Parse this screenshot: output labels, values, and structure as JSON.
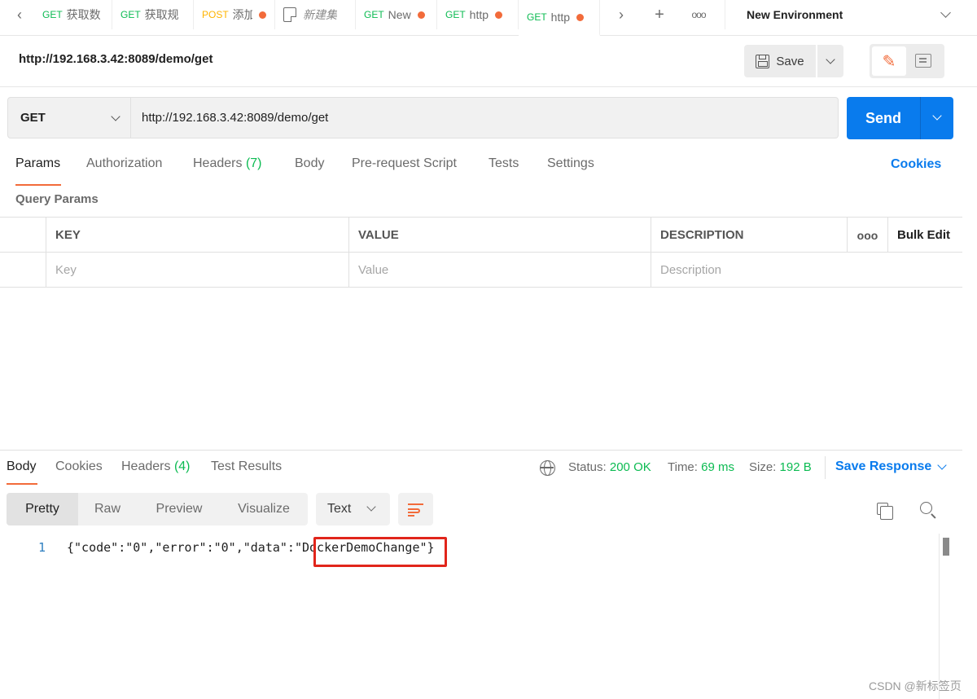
{
  "tabs": [
    {
      "method": "GET",
      "name": "获取数",
      "dot": false
    },
    {
      "method": "GET",
      "name": "获取规",
      "dot": false
    },
    {
      "method": "POST",
      "name": "添加",
      "dot": true
    },
    {
      "method": "",
      "name": "新建集",
      "dot": false
    },
    {
      "method": "GET",
      "name": "New",
      "dot": true
    },
    {
      "method": "GET",
      "name": "http",
      "dot": true
    },
    {
      "method": "GET",
      "name": "http",
      "dot": true
    }
  ],
  "environment": {
    "label": "New Environment"
  },
  "request": {
    "title": "http://192.168.3.42:8089/demo/get",
    "save_label": "Save",
    "method": "GET",
    "url": "http://192.168.3.42:8089/demo/get",
    "send_label": "Send"
  },
  "request_tabs": {
    "params": "Params",
    "authorization": "Authorization",
    "headers": "Headers",
    "headers_count": "(7)",
    "body": "Body",
    "prerequest": "Pre-request Script",
    "tests": "Tests",
    "settings": "Settings",
    "cookies": "Cookies"
  },
  "query_params": {
    "label": "Query Params",
    "columns": {
      "key": "KEY",
      "value": "VALUE",
      "description": "DESCRIPTION",
      "bulk_edit": "Bulk Edit"
    },
    "placeholders": {
      "key": "Key",
      "value": "Value",
      "description": "Description"
    }
  },
  "response": {
    "tabs": {
      "body": "Body",
      "cookies": "Cookies",
      "headers": "Headers",
      "headers_count": "(4)",
      "test_results": "Test Results"
    },
    "status_label": "Status:",
    "status_value": "200 OK",
    "time_label": "Time:",
    "time_value": "69 ms",
    "size_label": "Size:",
    "size_value": "192 B",
    "save_response": "Save Response",
    "views": {
      "pretty": "Pretty",
      "raw": "Raw",
      "preview": "Preview",
      "visualize": "Visualize"
    },
    "format": "Text",
    "line_number": "1",
    "body_text": "{\"code\":\"0\",\"error\":\"0\",\"data\":\"DockerDemoChange\"}"
  },
  "watermark": "CSDN @新标签页",
  "colors": {
    "accent": "#f26b3a",
    "primary": "#097bed",
    "success": "#0cbb52",
    "highlight": "#e1251b"
  }
}
